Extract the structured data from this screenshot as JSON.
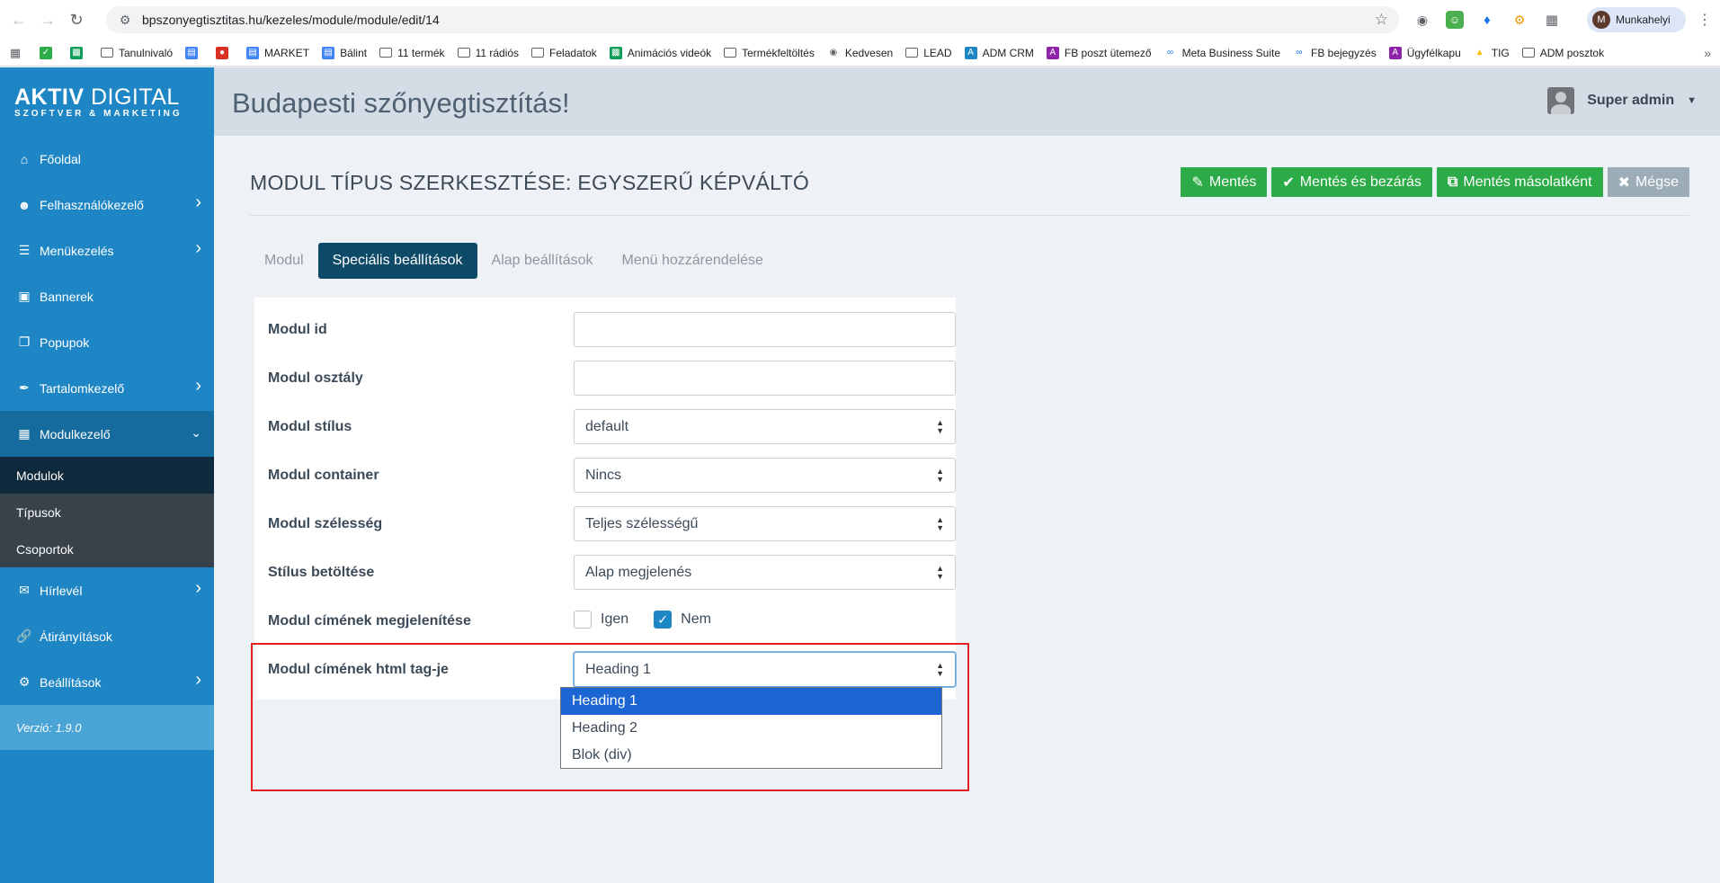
{
  "browser": {
    "url": "bpszonyegtisztitas.hu/kezeles/module/module/edit/14",
    "profile_initial": "M",
    "profile_name": "Munkahelyi"
  },
  "bookmarks": [
    {
      "label": "",
      "icon": "green-check-icon",
      "color": "#2dab48"
    },
    {
      "label": "",
      "icon": "sheets-icon",
      "color": "#0f9d58"
    },
    {
      "label": "Tanulnivaló",
      "icon": "folder-icon"
    },
    {
      "label": "",
      "icon": "docs-icon",
      "color": "#4285f4"
    },
    {
      "label": "",
      "icon": "red-app-icon",
      "color": "#d93025"
    },
    {
      "label": "MARKET",
      "icon": "docs-icon",
      "color": "#4285f4"
    },
    {
      "label": "Bálint",
      "icon": "docs-icon",
      "color": "#4285f4"
    },
    {
      "label": "11 termék",
      "icon": "folder-icon"
    },
    {
      "label": "11 rádiós",
      "icon": "folder-icon"
    },
    {
      "label": "Feladatok",
      "icon": "folder-icon"
    },
    {
      "label": "Animációs videók",
      "icon": "sheets-icon",
      "color": "#0f9d58"
    },
    {
      "label": "Termékfeltöltés",
      "icon": "folder-icon"
    },
    {
      "label": "Kedvesen",
      "icon": "globe-icon",
      "color": "#5f6368"
    },
    {
      "label": "LEAD",
      "icon": "folder-icon"
    },
    {
      "label": "ADM CRM",
      "icon": "a-icon",
      "color": "#1e86c4"
    },
    {
      "label": "FB poszt ütemező",
      "icon": "a-icon",
      "color": "#8e24aa"
    },
    {
      "label": "Meta Business Suite",
      "icon": "meta-icon",
      "color": "#1877f2"
    },
    {
      "label": "FB bejegyzés",
      "icon": "meta-icon",
      "color": "#1877f2"
    },
    {
      "label": "Ügyfélkapu",
      "icon": "a-icon",
      "color": "#8e24aa"
    },
    {
      "label": "TIG",
      "icon": "drive-icon",
      "color": "#fbbc04"
    },
    {
      "label": "ADM posztok",
      "icon": "folder-icon"
    }
  ],
  "sidebar": {
    "logo_main": "AKTIV",
    "logo_rest": " DIGITAL",
    "logo_sub": "SZOFTVER & MARKETING",
    "items": [
      {
        "label": "Főoldal",
        "icon": "home-icon",
        "chevron": false
      },
      {
        "label": "Felhasználókezelő",
        "icon": "users-icon",
        "chevron": true
      },
      {
        "label": "Menükezelés",
        "icon": "list-icon",
        "chevron": true
      },
      {
        "label": "Bannerek",
        "icon": "banner-icon",
        "chevron": false
      },
      {
        "label": "Popupok",
        "icon": "popup-icon",
        "chevron": false
      },
      {
        "label": "Tartalomkezelő",
        "icon": "feather-icon",
        "chevron": true
      },
      {
        "label": "Modulkezelő",
        "icon": "grid-icon",
        "chevron": true
      }
    ],
    "subitems": [
      {
        "label": "Modulok"
      },
      {
        "label": "Típusok"
      },
      {
        "label": "Csoportok"
      }
    ],
    "items_after": [
      {
        "label": "Hírlevél",
        "icon": "envelope-icon",
        "chevron": true
      },
      {
        "label": "Átirányítások",
        "icon": "link-icon",
        "chevron": false
      },
      {
        "label": "Beállítások",
        "icon": "settings-icon",
        "chevron": true
      }
    ],
    "version": "Verzió: 1.9.0"
  },
  "header": {
    "title": "Budapesti szőnyegtisztítás!",
    "user": "Super admin"
  },
  "page": {
    "title": "MODUL TÍPUS SZERKESZTÉSE: EGYSZERŰ KÉPVÁLTÓ",
    "actions": [
      {
        "label": "Mentés",
        "icon": "pencil-icon",
        "style": "green"
      },
      {
        "label": "Mentés és bezárás",
        "icon": "check-icon",
        "style": "green"
      },
      {
        "label": "Mentés másolatként",
        "icon": "copy-icon",
        "style": "green"
      },
      {
        "label": "Mégse",
        "icon": "close-icon",
        "style": "grey"
      }
    ],
    "tabs": [
      {
        "label": "Modul",
        "active": false
      },
      {
        "label": "Speciális beállítások",
        "active": true
      },
      {
        "label": "Alap beállítások",
        "active": false
      },
      {
        "label": "Menü hozzárendelése",
        "active": false
      }
    ]
  },
  "form": {
    "modul_id": {
      "label": "Modul id",
      "value": ""
    },
    "modul_osztaly": {
      "label": "Modul osztály",
      "value": ""
    },
    "modul_stilus": {
      "label": "Modul stílus",
      "value": "default"
    },
    "modul_container": {
      "label": "Modul container",
      "value": "Nincs"
    },
    "modul_szelesseg": {
      "label": "Modul szélesség",
      "value": "Teljes szélességű"
    },
    "stilus_betoltese": {
      "label": "Stílus betöltése",
      "value": "Alap megjelenés"
    },
    "cim_megjelenitese": {
      "label": "Modul címének megjelenítése",
      "opt_yes": "Igen",
      "opt_no": "Nem",
      "checked": "Nem"
    },
    "cim_html_tag": {
      "label": "Modul címének html tag-je",
      "value": "Heading 1",
      "options": [
        "Heading 1",
        "Heading 2",
        "Blok (div)"
      ]
    }
  },
  "colors": {
    "sidebar": "#1e86c4",
    "active_tab": "#0d4a68",
    "save_green": "#2dab48",
    "highlight": "#e31e1e"
  }
}
